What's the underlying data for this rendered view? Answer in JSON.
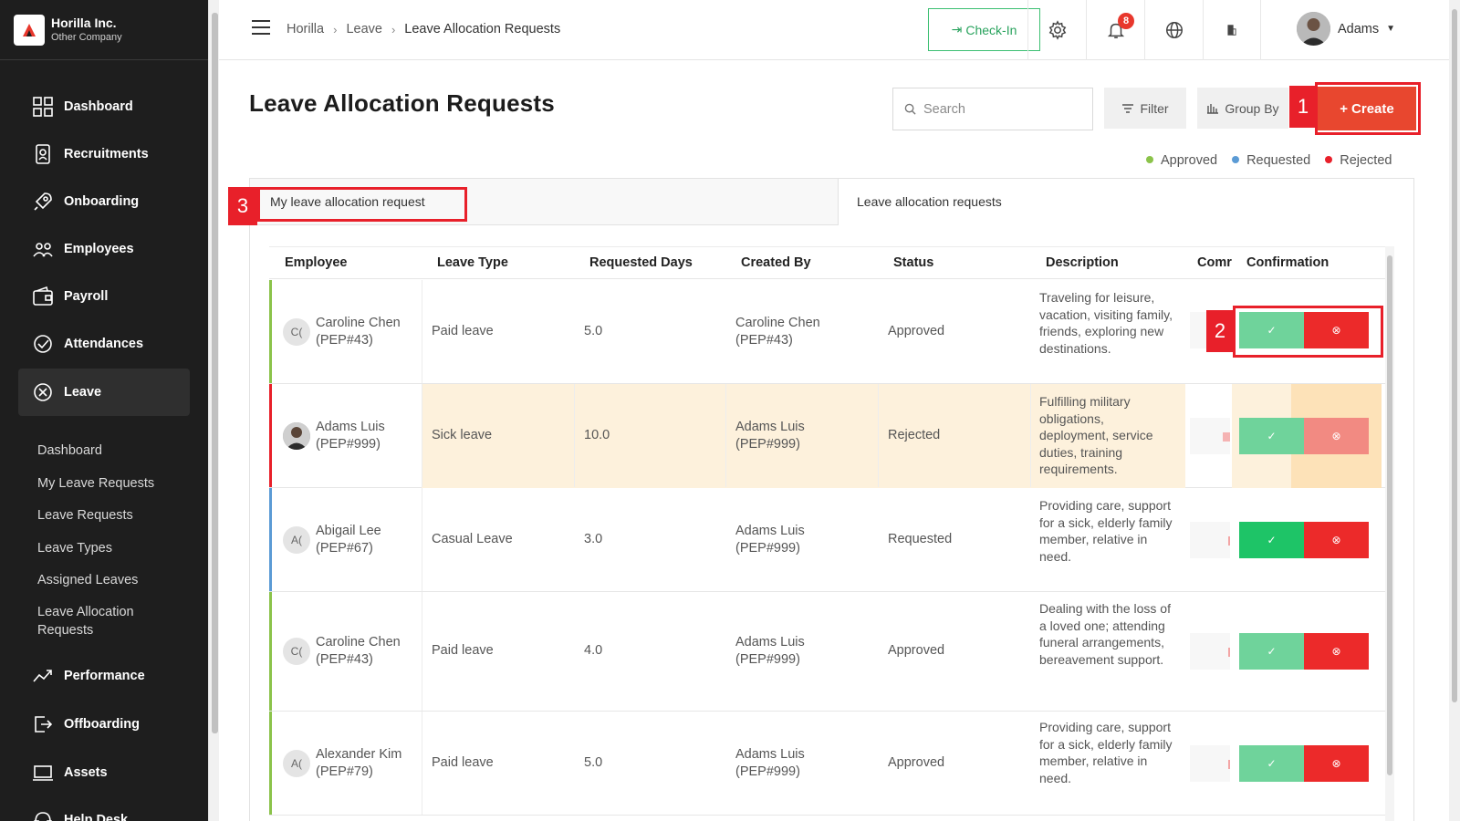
{
  "brand": {
    "name": "Horilla Inc.",
    "subtitle": "Other Company"
  },
  "sidebar": {
    "items": [
      {
        "label": "Dashboard",
        "icon": "dashboard-icon"
      },
      {
        "label": "Recruitments",
        "icon": "recruitment-icon"
      },
      {
        "label": "Onboarding",
        "icon": "rocket-icon"
      },
      {
        "label": "Employees",
        "icon": "people-icon"
      },
      {
        "label": "Payroll",
        "icon": "wallet-icon"
      },
      {
        "label": "Attendances",
        "icon": "check-circle-icon"
      },
      {
        "label": "Leave",
        "icon": "leave-icon",
        "active": true
      },
      {
        "label": "Performance",
        "icon": "trend-icon"
      },
      {
        "label": "Offboarding",
        "icon": "exit-icon"
      },
      {
        "label": "Assets",
        "icon": "laptop-icon"
      },
      {
        "label": "Help Desk",
        "icon": "headset-icon"
      }
    ],
    "leave_sub": [
      "Dashboard",
      "My Leave Requests",
      "Leave Requests",
      "Leave Types",
      "Assigned Leaves",
      "Leave Allocation Requests"
    ]
  },
  "header": {
    "breadcrumb": [
      "Horilla",
      "Leave",
      "Leave Allocation Requests"
    ],
    "checkin_label": "Check-In",
    "notification_count": "8",
    "user_name": "Adams"
  },
  "page": {
    "title": "Leave Allocation Requests",
    "search_placeholder": "Search",
    "filter_label": "Filter",
    "groupby_label": "Group By",
    "create_label": "Create"
  },
  "annotations": [
    "1",
    "2",
    "3"
  ],
  "legend": [
    {
      "label": "Approved",
      "color": "#8bc34a"
    },
    {
      "label": "Requested",
      "color": "#5b9bd5"
    },
    {
      "label": "Rejected",
      "color": "#e8202a"
    }
  ],
  "tabs": {
    "my_requests": "My leave allocation request",
    "all_requests": "Leave allocation requests"
  },
  "table": {
    "columns": [
      "Employee",
      "Leave Type",
      "Requested Days",
      "Created By",
      "Status",
      "Description",
      "Comr",
      "Confirmation"
    ],
    "rows": [
      {
        "initials": "C(",
        "employee": "Caroline Chen",
        "emp_id": "(PEP#43)",
        "leave_type": "Paid leave",
        "days": "5.0",
        "created_by": "Caroline Chen",
        "created_id": "(PEP#43)",
        "status": "Approved",
        "description": "Traveling for leisure, vacation, visiting family, friends, exploring new destinations."
      },
      {
        "initials": "",
        "employee": "Adams Luis",
        "emp_id": "(PEP#999)",
        "leave_type": "Sick leave",
        "days": "10.0",
        "created_by": "Adams Luis",
        "created_id": "(PEP#999)",
        "status": "Rejected",
        "description": "Fulfilling military obligations, deployment, service duties, training requirements."
      },
      {
        "initials": "A(",
        "employee": "Abigail Lee",
        "emp_id": "(PEP#67)",
        "leave_type": "Casual Leave",
        "days": "3.0",
        "created_by": "Adams Luis",
        "created_id": "(PEP#999)",
        "status": "Requested",
        "description": "Providing care, support for a sick, elderly family member, relative in need."
      },
      {
        "initials": "C(",
        "employee": "Caroline Chen",
        "emp_id": "(PEP#43)",
        "leave_type": "Paid leave",
        "days": "4.0",
        "created_by": "Adams Luis",
        "created_id": "(PEP#999)",
        "status": "Approved",
        "description": "Dealing with the loss of a loved one; attending funeral arrangements, bereavement support."
      },
      {
        "initials": "A(",
        "employee": "Alexander Kim",
        "emp_id": "(PEP#79)",
        "leave_type": "Paid leave",
        "days": "5.0",
        "created_by": "Adams Luis",
        "created_id": "(PEP#999)",
        "status": "Approved",
        "description": "Providing care, support for a sick, elderly family member, relative in need."
      }
    ]
  }
}
